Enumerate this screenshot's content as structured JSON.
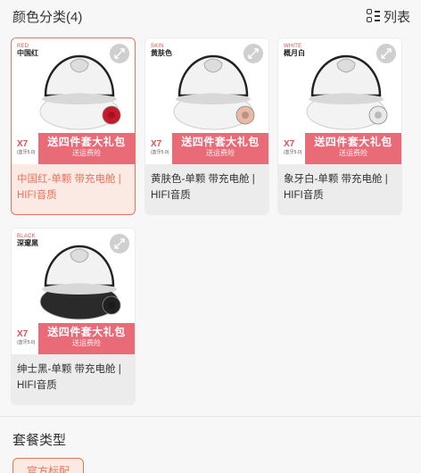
{
  "header": {
    "title": "颜色分类(4)",
    "toggle_label": "列表"
  },
  "variants": [
    {
      "color_en": "RED",
      "color_cn": "中国红",
      "model": "X7",
      "version": "(蓝牙5.0)",
      "promo_main": "送四件套大礼包",
      "promo_sub": "送运费险",
      "name": "中国红-单颗 带充电舱 | HIFI音质",
      "bud_color": "#c8192b",
      "case_color": "#f3f3f3"
    },
    {
      "color_en": "SKIN",
      "color_cn": "黄肤色",
      "model": "X7",
      "version": "(蓝牙5.0)",
      "promo_main": "送四件套大礼包",
      "promo_sub": "送运费险",
      "name": "黄肤色-单颗 带充电舱 | HIFI音质",
      "bud_color": "#e8b9a6",
      "case_color": "#f3f3f3"
    },
    {
      "color_en": "WHITE",
      "color_cn": "概月白",
      "model": "X7",
      "version": "(蓝牙5.0)",
      "promo_main": "送四件套大礼包",
      "promo_sub": "送运费险",
      "name": "象牙白-单颗 带充电舱 | HIFI音质",
      "bud_color": "#e9e9e9",
      "case_color": "#f3f3f3"
    },
    {
      "color_en": "BLACK",
      "color_cn": "深邃黑",
      "model": "X7",
      "version": "(蓝牙5.0)",
      "promo_main": "送四件套大礼包",
      "promo_sub": "送运费险",
      "name": "绅士黑-单颗 带充电舱 | HIFI音质",
      "bud_color": "#222222",
      "case_color": "#2a2a2a"
    }
  ],
  "package": {
    "title": "套餐类型",
    "option": "官方标配"
  },
  "colors": {
    "accent": "#e8735a",
    "promo": "#e96b78"
  }
}
